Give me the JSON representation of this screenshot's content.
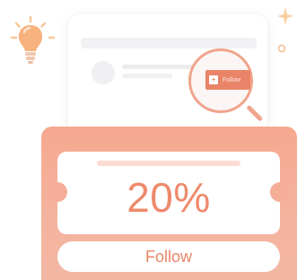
{
  "illustration": {
    "magnifier": {
      "follow_label": "Follow"
    }
  },
  "coupon": {
    "discount": "20%",
    "follow_label": "Follow"
  },
  "colors": {
    "accent": "#ea8468",
    "panel": "#f6a88f",
    "bulb": "#f6a96e"
  },
  "icons": [
    "light-bulb-icon",
    "sparkle-icon",
    "magnifier-icon"
  ]
}
